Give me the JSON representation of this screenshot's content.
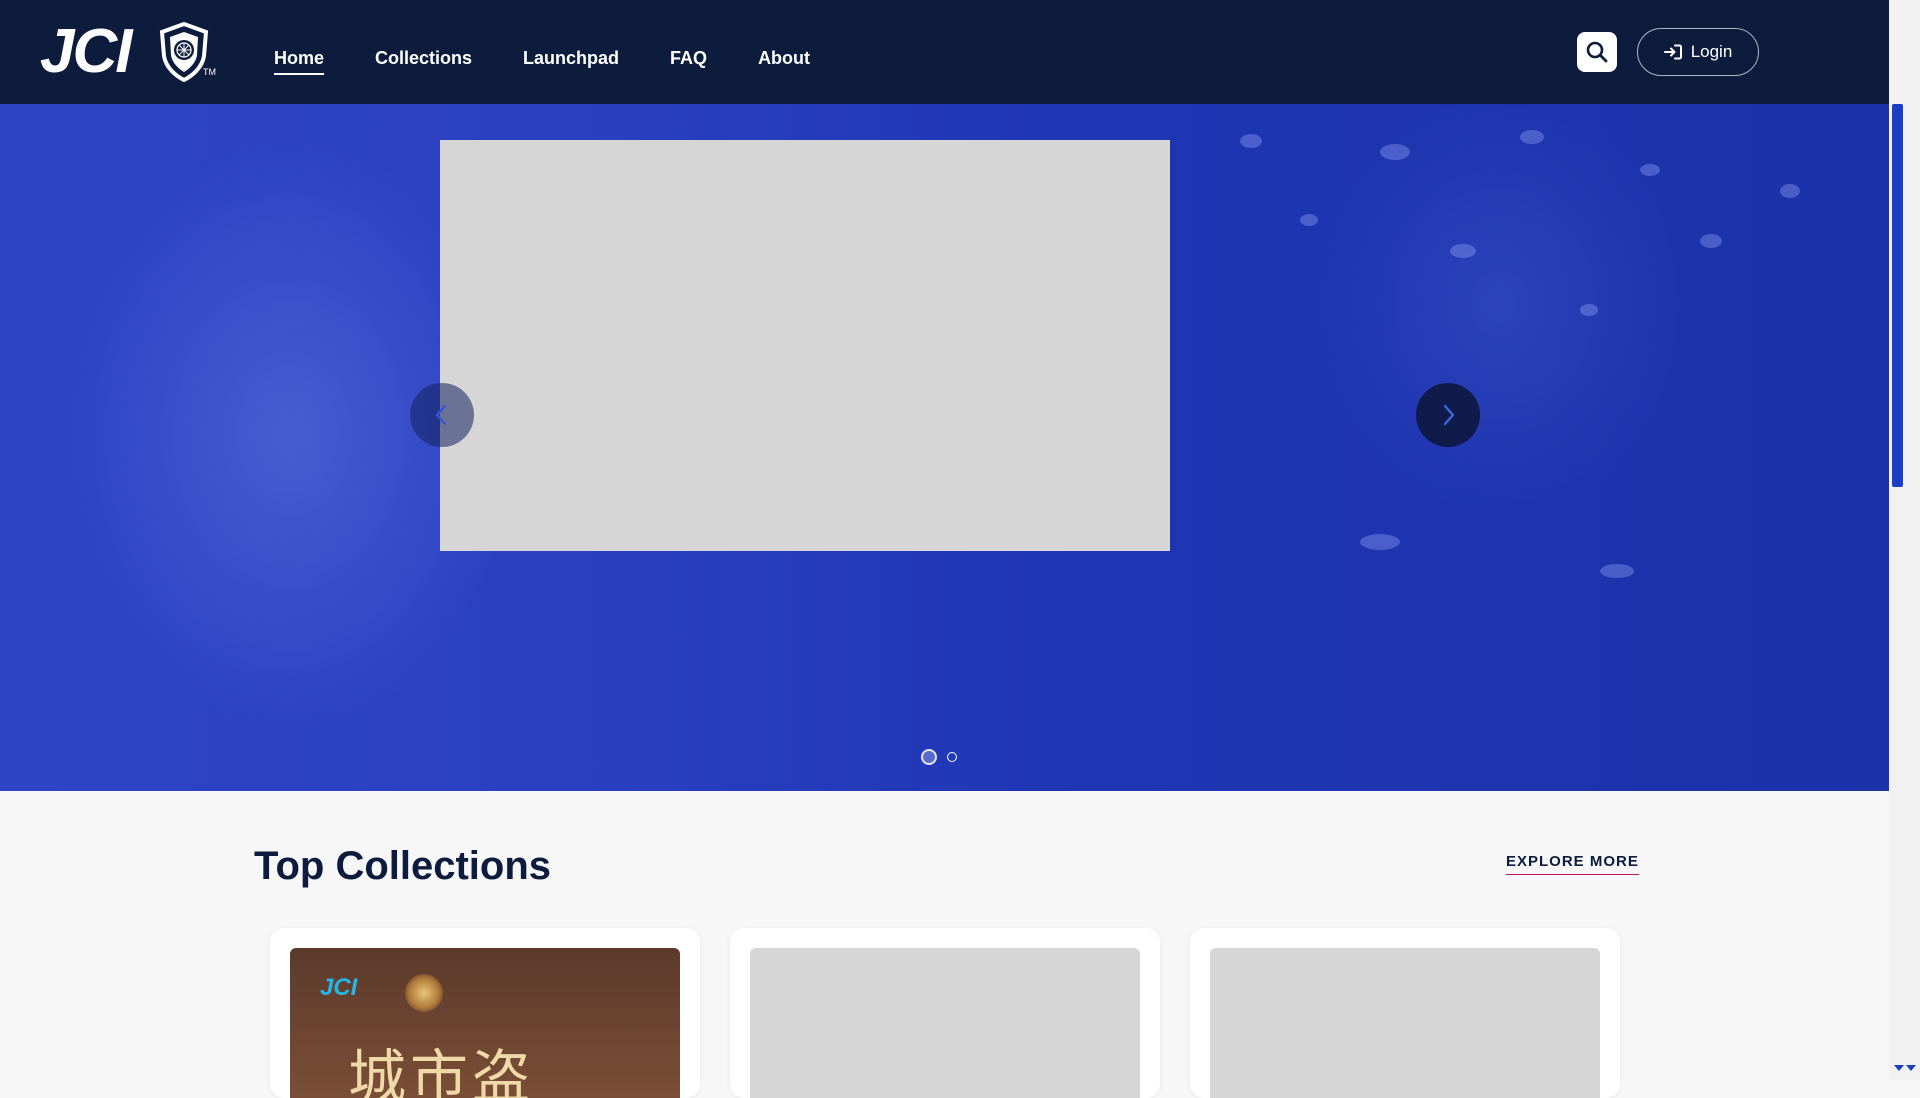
{
  "header": {
    "logo_text": "JCI",
    "logo_tm": "TM",
    "nav": [
      {
        "label": "Home",
        "active": true
      },
      {
        "label": "Collections",
        "active": false
      },
      {
        "label": "Launchpad",
        "active": false
      },
      {
        "label": "FAQ",
        "active": false
      },
      {
        "label": "About",
        "active": false
      }
    ],
    "search_icon": "search-icon",
    "login_label": "Login",
    "login_icon": "sign-in-icon"
  },
  "hero": {
    "prev_icon": "chevron-left-icon",
    "next_icon": "chevron-right-icon",
    "slide_count": 2,
    "active_slide": 1
  },
  "collections": {
    "title": "Top Collections",
    "explore_label": "EXPLORE MORE",
    "cards": [
      {
        "poster_logo": "JCI",
        "poster_title": "城市盗"
      },
      {},
      {}
    ]
  },
  "colors": {
    "header_bg": "#0d1b3d",
    "hero_blue": "#2a40c0",
    "accent_underline": "#c2185b",
    "placeholder_gray": "#d6d6d6"
  }
}
